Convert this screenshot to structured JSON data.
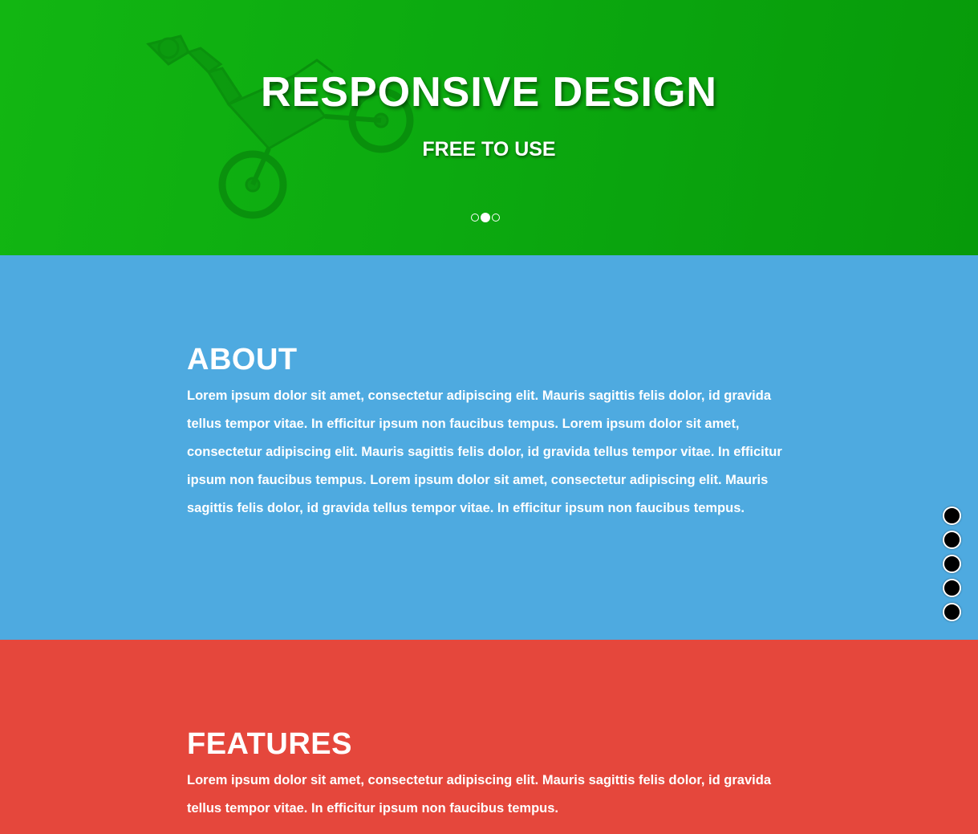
{
  "hero": {
    "title": "RESPONSIVE DESIGN",
    "subtitle": "FREE TO USE",
    "image_icon": "motocross-rider-image",
    "slider_dots": [
      {
        "active": false
      },
      {
        "active": true
      },
      {
        "active": false
      }
    ]
  },
  "about": {
    "title": "ABOUT",
    "text": "Lorem ipsum dolor sit amet, consectetur adipiscing elit. Mauris sagittis felis dolor, id gravida tellus tempor vitae. In efficitur ipsum non faucibus tempus. Lorem ipsum dolor sit amet, consectetur adipiscing elit. Mauris sagittis felis dolor, id gravida tellus tempor vitae. In efficitur ipsum non faucibus tempus. Lorem ipsum dolor sit amet, consectetur adipiscing elit. Mauris sagittis felis dolor, id gravida tellus tempor vitae. In efficitur ipsum non faucibus tempus."
  },
  "features": {
    "title": "FEATURES",
    "text": "Lorem ipsum dolor sit amet, consectetur adipiscing elit. Mauris sagittis felis dolor, id gravida tellus tempor vitae. In efficitur ipsum non faucibus tempus."
  },
  "side_nav": {
    "count": 5
  },
  "colors": {
    "hero_green": "#0caa10",
    "about_blue": "#4eaae0",
    "features_red": "#e5473c",
    "text": "#ffffff",
    "nav_dot": "#000000"
  }
}
